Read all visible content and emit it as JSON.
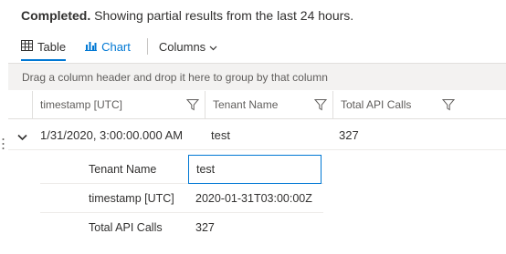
{
  "status": {
    "bold_text": "Completed.",
    "text": "Showing partial results from the last 24 hours."
  },
  "toolbar": {
    "table_label": "Table",
    "chart_label": "Chart",
    "columns_label": "Columns",
    "table_icon": "table-grid-icon",
    "chart_icon": "bar-chart-icon",
    "accent_color": "#0078d4"
  },
  "group_bar": {
    "text": "Drag a column header and drop it here to group by that column"
  },
  "grid": {
    "columns": [
      {
        "label": "timestamp [UTC]"
      },
      {
        "label": "Tenant Name"
      },
      {
        "label": "Total API Calls"
      }
    ],
    "rows": [
      {
        "expanded": true,
        "cells": [
          "1/31/2020, 3:00:00.000 AM",
          "test",
          "327"
        ]
      }
    ]
  },
  "detail": {
    "rows": [
      {
        "label": "Tenant Name",
        "value": "test"
      },
      {
        "label": "timestamp [UTC]",
        "value": "2020-01-31T03:00:00Z"
      },
      {
        "label": "Total API Calls",
        "value": "327"
      }
    ]
  }
}
